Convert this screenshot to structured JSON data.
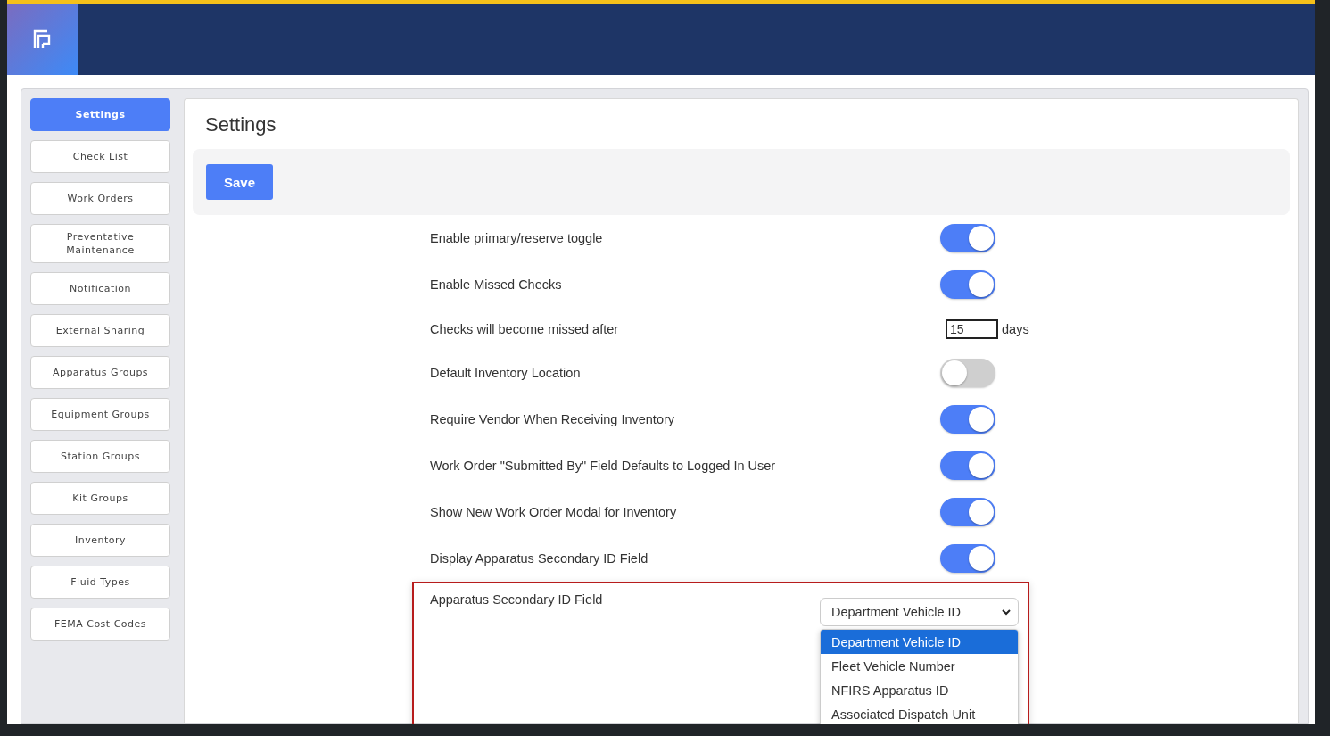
{
  "sidebar": {
    "items": [
      {
        "label": "Settings",
        "selected": true
      },
      {
        "label": "Check List",
        "selected": false
      },
      {
        "label": "Work Orders",
        "selected": false
      },
      {
        "label": "Preventative Maintenance",
        "selected": false
      },
      {
        "label": "Notification",
        "selected": false
      },
      {
        "label": "External Sharing",
        "selected": false
      },
      {
        "label": "Apparatus Groups",
        "selected": false
      },
      {
        "label": "Equipment Groups",
        "selected": false
      },
      {
        "label": "Station Groups",
        "selected": false
      },
      {
        "label": "Kit Groups",
        "selected": false
      },
      {
        "label": "Inventory",
        "selected": false
      },
      {
        "label": "Fluid Types",
        "selected": false
      },
      {
        "label": "FEMA Cost Codes",
        "selected": false
      }
    ]
  },
  "page": {
    "title": "Settings",
    "save_button": "Save"
  },
  "settings": [
    {
      "kind": "toggle",
      "label": "Enable primary/reserve toggle",
      "on": true
    },
    {
      "kind": "toggle",
      "label": "Enable Missed Checks",
      "on": true
    },
    {
      "kind": "number",
      "label": "Checks will become missed after",
      "value": "15",
      "unit": "days"
    },
    {
      "kind": "toggle",
      "label": "Default Inventory Location",
      "on": false
    },
    {
      "kind": "toggle",
      "label": "Require Vendor When Receiving Inventory",
      "on": true
    },
    {
      "kind": "toggle",
      "label": "Work Order \"Submitted By\" Field Defaults to Logged In User",
      "on": true
    },
    {
      "kind": "toggle",
      "label": "Show New Work Order Modal for Inventory",
      "on": true
    },
    {
      "kind": "toggle",
      "label": "Display Apparatus Secondary ID Field",
      "on": true
    },
    {
      "kind": "select",
      "label": "Apparatus Secondary ID Field",
      "value": "Department Vehicle ID",
      "highlighted": true,
      "expanded": true,
      "options": [
        {
          "label": "Department Vehicle ID",
          "selected": true
        },
        {
          "label": "Fleet Vehicle Number",
          "selected": false
        },
        {
          "label": "NFIRS Apparatus ID",
          "selected": false
        },
        {
          "label": "Associated Dispatch Unit",
          "selected": false
        }
      ]
    }
  ]
}
